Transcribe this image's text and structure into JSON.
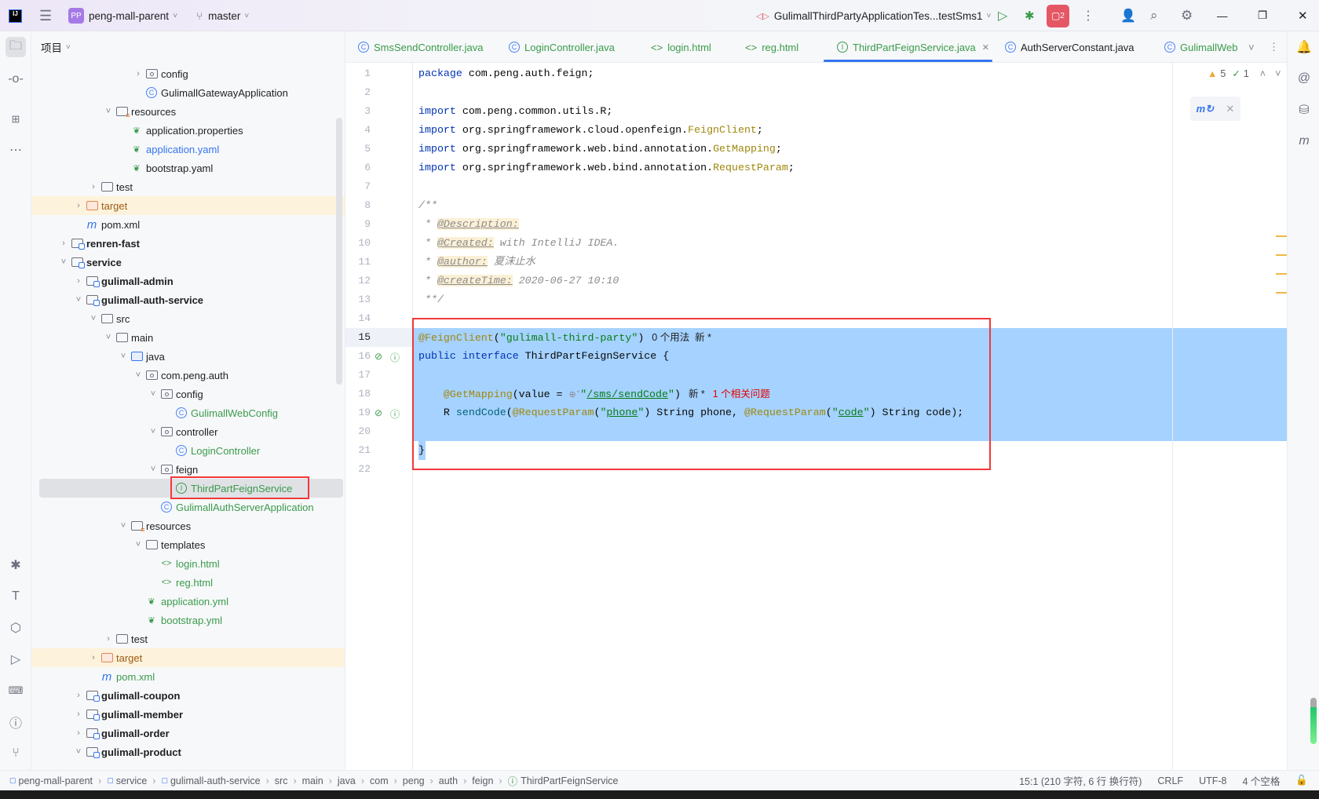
{
  "titlebar": {
    "project_badge": "PP",
    "project_name": "peng-mall-parent",
    "branch": "master",
    "run_config": "GulimallThirdPartyApplicationTes...testSms1",
    "notifications_badge": "2"
  },
  "project_panel": {
    "title": "项目",
    "tree": [
      {
        "label": "config",
        "level": 5,
        "icon": "pkg",
        "expanded": false,
        "color": "default"
      },
      {
        "label": "GulimallGatewayApplication",
        "level": 5,
        "icon": "spring-boot-class",
        "leaf": true,
        "color": "default"
      },
      {
        "label": "resources",
        "level": 3,
        "icon": "res",
        "expanded": true,
        "color": "default"
      },
      {
        "label": "application.properties",
        "level": 4,
        "icon": "spring-config",
        "leaf": true,
        "color": "default"
      },
      {
        "label": "application.yaml",
        "level": 4,
        "icon": "spring-config",
        "leaf": true,
        "color": "modified"
      },
      {
        "label": "bootstrap.yaml",
        "level": 4,
        "icon": "spring-config",
        "leaf": true,
        "color": "default"
      },
      {
        "label": "test",
        "level": 2,
        "icon": "folder",
        "expanded": false,
        "color": "default"
      },
      {
        "label": "target",
        "level": 1,
        "icon": "target",
        "expanded": false,
        "color": "excluded"
      },
      {
        "label": "pom.xml",
        "level": 1,
        "icon": "maven",
        "leaf": true,
        "color": "default"
      },
      {
        "label": "renren-fast",
        "level": 0,
        "icon": "module",
        "expanded": false,
        "bold": true
      },
      {
        "label": "service",
        "level": 0,
        "icon": "module",
        "expanded": true,
        "bold": true
      },
      {
        "label": "gulimall-admin",
        "level": 1,
        "icon": "module",
        "expanded": false,
        "bold": true
      },
      {
        "label": "gulimall-auth-service",
        "level": 1,
        "icon": "module",
        "expanded": true,
        "bold": true
      },
      {
        "label": "src",
        "level": 2,
        "icon": "folder",
        "expanded": true,
        "color": "default"
      },
      {
        "label": "main",
        "level": 3,
        "icon": "folder",
        "expanded": true,
        "color": "default"
      },
      {
        "label": "java",
        "level": 4,
        "icon": "java",
        "expanded": true,
        "color": "default"
      },
      {
        "label": "com.peng.auth",
        "level": 5,
        "icon": "pkg",
        "expanded": true,
        "color": "default"
      },
      {
        "label": "config",
        "level": 6,
        "icon": "pkg",
        "expanded": true,
        "color": "default"
      },
      {
        "label": "GulimallWebConfig",
        "level": 7,
        "icon": "class",
        "leaf": true,
        "color": "added"
      },
      {
        "label": "controller",
        "level": 6,
        "icon": "pkg",
        "expanded": true,
        "color": "default"
      },
      {
        "label": "LoginController",
        "level": 7,
        "icon": "class",
        "leaf": true,
        "color": "added"
      },
      {
        "label": "feign",
        "level": 6,
        "icon": "pkg",
        "expanded": true,
        "color": "default"
      },
      {
        "label": "ThirdPartFeignService",
        "level": 7,
        "icon": "interface",
        "leaf": true,
        "color": "added",
        "selected": true
      },
      {
        "label": "GulimallAuthServerApplication",
        "level": 6,
        "icon": "spring-boot-class",
        "leaf": true,
        "color": "added"
      },
      {
        "label": "resources",
        "level": 4,
        "icon": "res",
        "expanded": true,
        "color": "default"
      },
      {
        "label": "templates",
        "level": 5,
        "icon": "folder",
        "expanded": true,
        "color": "default"
      },
      {
        "label": "login.html",
        "level": 6,
        "icon": "html",
        "leaf": true,
        "color": "added"
      },
      {
        "label": "reg.html",
        "level": 6,
        "icon": "html",
        "leaf": true,
        "color": "added"
      },
      {
        "label": "application.yml",
        "level": 5,
        "icon": "spring-config",
        "leaf": true,
        "color": "added"
      },
      {
        "label": "bootstrap.yml",
        "level": 5,
        "icon": "spring-config",
        "leaf": true,
        "color": "added"
      },
      {
        "label": "test",
        "level": 3,
        "icon": "folder",
        "expanded": false,
        "color": "default"
      },
      {
        "label": "target",
        "level": 2,
        "icon": "target",
        "expanded": false,
        "color": "excluded"
      },
      {
        "label": "pom.xml",
        "level": 2,
        "icon": "maven",
        "leaf": true,
        "color": "added"
      },
      {
        "label": "gulimall-coupon",
        "level": 1,
        "icon": "module",
        "expanded": false,
        "bold": true
      },
      {
        "label": "gulimall-member",
        "level": 1,
        "icon": "module",
        "expanded": false,
        "bold": true
      },
      {
        "label": "gulimall-order",
        "level": 1,
        "icon": "module",
        "expanded": false,
        "bold": true
      },
      {
        "label": "gulimall-product",
        "level": 1,
        "icon": "module",
        "expanded": true,
        "bold": true
      }
    ]
  },
  "tabs": [
    {
      "label": "SmsSendController.java",
      "icon": "class",
      "color": "added"
    },
    {
      "label": "LoginController.java",
      "icon": "class",
      "color": "added"
    },
    {
      "label": "login.html",
      "icon": "html",
      "color": "added"
    },
    {
      "label": "reg.html",
      "icon": "html",
      "color": "added"
    },
    {
      "label": "ThirdPartFeignService.java",
      "icon": "interface",
      "color": "added",
      "active": true
    },
    {
      "label": "AuthServerConstant.java",
      "icon": "class",
      "color": "default"
    },
    {
      "label": "GulimallWeb",
      "icon": "class",
      "color": "added"
    }
  ],
  "editor": {
    "warnings": "5",
    "weak_warnings": "1",
    "lines": [
      {
        "n": "1",
        "tokens": [
          [
            "kw",
            "package"
          ],
          [
            "p",
            " com.peng.auth.feign;"
          ]
        ]
      },
      {
        "n": "2",
        "tokens": []
      },
      {
        "n": "3",
        "tokens": [
          [
            "kw",
            "import"
          ],
          [
            "p",
            " com.peng.common.utils.R;"
          ]
        ]
      },
      {
        "n": "4",
        "tokens": [
          [
            "kw",
            "import"
          ],
          [
            "p",
            " org.springframework.cloud.openfeign."
          ],
          [
            "ann",
            "FeignClient"
          ],
          [
            "p",
            ";"
          ]
        ]
      },
      {
        "n": "5",
        "tokens": [
          [
            "kw",
            "import"
          ],
          [
            "p",
            " org.springframework.web.bind.annotation."
          ],
          [
            "ann",
            "GetMapping"
          ],
          [
            "p",
            ";"
          ]
        ]
      },
      {
        "n": "6",
        "tokens": [
          [
            "kw",
            "import"
          ],
          [
            "p",
            " org.springframework.web.bind.annotation."
          ],
          [
            "ann",
            "RequestParam"
          ],
          [
            "p",
            ";"
          ]
        ]
      },
      {
        "n": "7",
        "tokens": []
      },
      {
        "n": "8",
        "tokens": [
          [
            "cm",
            "/**"
          ]
        ]
      },
      {
        "n": "9",
        "tokens": [
          [
            "cm",
            " * "
          ],
          [
            "doctag",
            "@Description:"
          ]
        ]
      },
      {
        "n": "10",
        "tokens": [
          [
            "cm",
            " * "
          ],
          [
            "doctag",
            "@Created:"
          ],
          [
            "cm",
            " with IntelliJ IDEA."
          ]
        ]
      },
      {
        "n": "11",
        "tokens": [
          [
            "cm",
            " * "
          ],
          [
            "doctag",
            "@author:"
          ],
          [
            "cm",
            " 夏沫止水"
          ]
        ]
      },
      {
        "n": "12",
        "tokens": [
          [
            "cm",
            " * "
          ],
          [
            "doctag",
            "@createTime:"
          ],
          [
            "cm",
            " 2020-06-27 10:10"
          ]
        ]
      },
      {
        "n": "13",
        "tokens": [
          [
            "cm",
            " **/"
          ]
        ]
      },
      {
        "n": "14",
        "tokens": []
      },
      {
        "n": "15",
        "tokens": [
          [
            "ann",
            "@FeignClient"
          ],
          [
            "p",
            "("
          ],
          [
            "str",
            "\"gulimall-third-party\""
          ],
          [
            "p",
            ")"
          ],
          [
            "hint",
            "0 个用法  新 *"
          ]
        ]
      },
      {
        "n": "16",
        "tokens": [
          [
            "kw",
            "public interface"
          ],
          [
            "p",
            " ThirdPartFeignService {"
          ]
        ]
      },
      {
        "n": "17",
        "tokens": []
      },
      {
        "n": "18",
        "tokens": [
          [
            "p",
            "    "
          ],
          [
            "ann",
            "@GetMapping"
          ],
          [
            "p",
            "(value = "
          ],
          [
            "globe",
            "⊕˅"
          ],
          [
            "str",
            "\""
          ],
          [
            "str ul",
            "/sms/sendCode"
          ],
          [
            "str",
            "\""
          ],
          [
            "p",
            ")"
          ],
          [
            "hint",
            "新 *"
          ],
          [
            "err",
            "1 个相关问题"
          ]
        ]
      },
      {
        "n": "19",
        "tokens": [
          [
            "p",
            "    R "
          ],
          [
            "fn",
            "sendCode"
          ],
          [
            "p",
            "("
          ],
          [
            "ann",
            "@RequestParam"
          ],
          [
            "p",
            "("
          ],
          [
            "str",
            "\""
          ],
          [
            "str ul",
            "phone"
          ],
          [
            "str",
            "\""
          ],
          [
            "p",
            ") String phone, "
          ],
          [
            "ann",
            "@RequestParam"
          ],
          [
            "p",
            "("
          ],
          [
            "str",
            "\""
          ],
          [
            "str ul",
            "code"
          ],
          [
            "str",
            "\""
          ],
          [
            "p",
            ") String code);"
          ]
        ]
      },
      {
        "n": "20",
        "tokens": []
      },
      {
        "n": "21",
        "tokens": [
          [
            "p",
            "}"
          ]
        ]
      },
      {
        "n": "22",
        "tokens": []
      }
    ]
  },
  "statusbar": {
    "breadcrumb": [
      "peng-mall-parent",
      "service",
      "gulimall-auth-service",
      "src",
      "main",
      "java",
      "com",
      "peng",
      "auth",
      "feign",
      "ThirdPartFeignService"
    ],
    "position": "15:1 (210 字符, 6 行 换行符)",
    "line_separator": "CRLF",
    "encoding": "UTF-8",
    "indent": "4 个空格"
  },
  "colors": {
    "added": "#3a9b4b",
    "modified": "#3574f0",
    "excluded": "#9c5b13",
    "default": "#1e1f22",
    "accent": "#3574f0",
    "selection": "#a6d2ff",
    "annotation_box": "#f2383a"
  }
}
